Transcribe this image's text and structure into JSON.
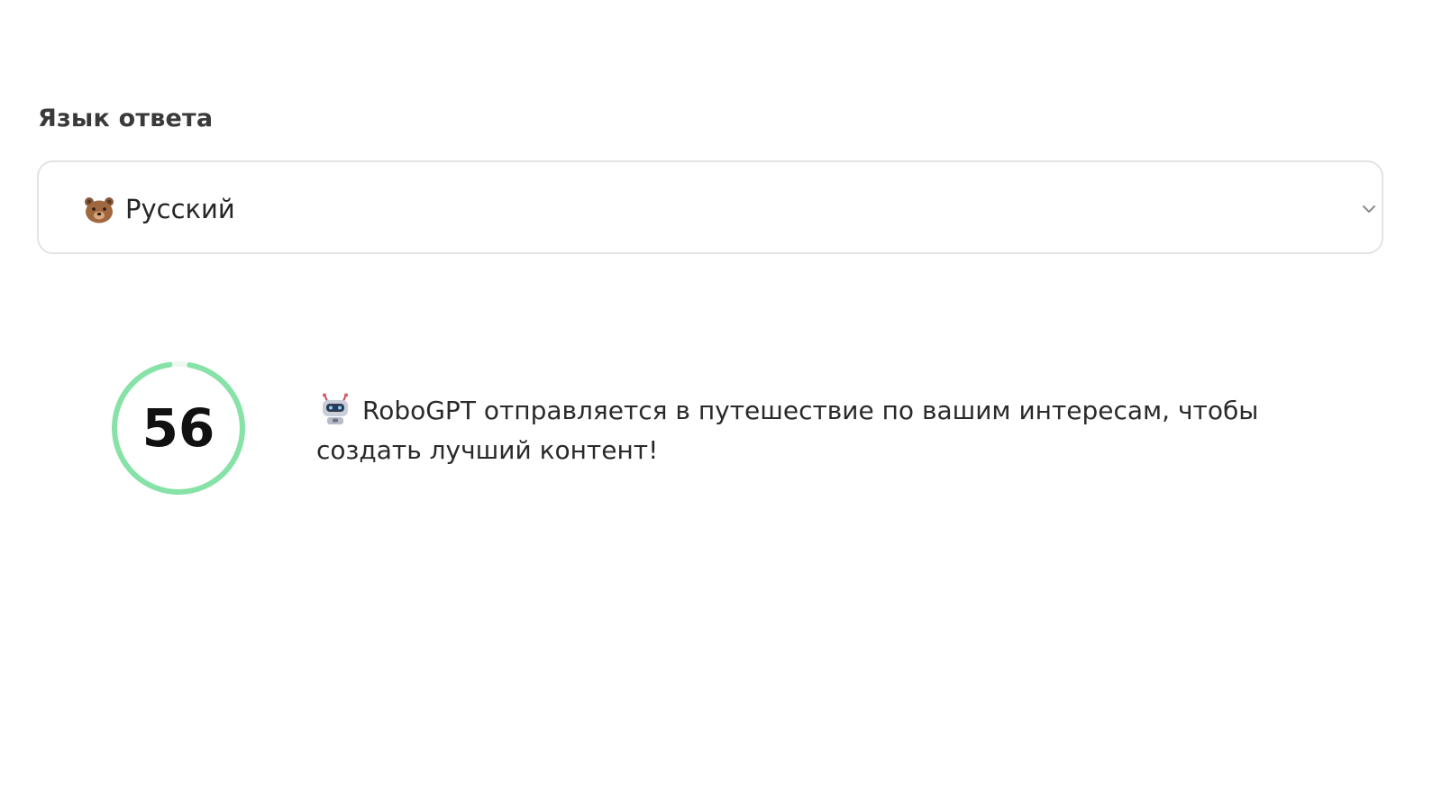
{
  "language": {
    "label": "Язык ответа",
    "selected_value": "Русский",
    "selected_icon": "bear-face-icon"
  },
  "progress": {
    "value": 56,
    "display": "56",
    "fraction": 0.95,
    "color": "#86e2a6",
    "track_color": "#eef8f1"
  },
  "status": {
    "icon": "robot-icon",
    "message": "RoboGPT отправляется в путешествие по вашим интересам, чтобы создать лучший контент!"
  }
}
